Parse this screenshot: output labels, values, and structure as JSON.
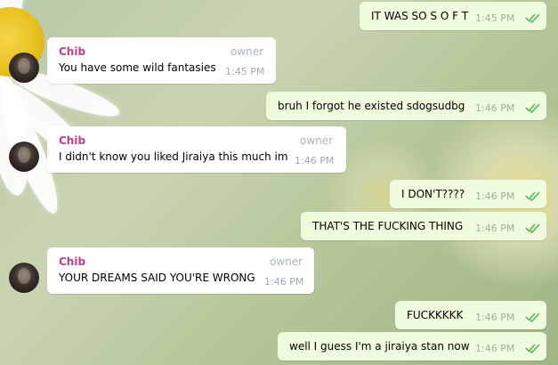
{
  "chat": {
    "colors": {
      "outgoing_bubble": "#effdde",
      "incoming_bubble": "#ffffff",
      "sender_name": "#c03d87",
      "read_check": "#5bb25b"
    },
    "messages": [
      {
        "direction": "out",
        "text": "IT WAS SO S O F T",
        "time": "1:45 PM",
        "status": "read"
      },
      {
        "direction": "in",
        "sender": "Chib",
        "role": "owner",
        "text": "You have some wild fantasies",
        "time": "1:45 PM"
      },
      {
        "direction": "out",
        "text": "bruh I forgot he existed sdogsudbg",
        "time": "1:46 PM",
        "status": "read"
      },
      {
        "direction": "in",
        "sender": "Chib",
        "role": "owner",
        "text": "I didn't know you liked Jiraiya this much im",
        "time": "1:46 PM"
      },
      {
        "direction": "out",
        "text": "I DON'T????",
        "time": "1:46 PM",
        "status": "read"
      },
      {
        "direction": "out",
        "text": "THAT'S THE FUCKING THING",
        "time": "1:46 PM",
        "status": "read"
      },
      {
        "direction": "in",
        "sender": "Chib",
        "role": "owner",
        "text": "YOUR DREAMS SAID YOU'RE WRONG",
        "time": "1:46 PM"
      },
      {
        "direction": "out",
        "text": "FUCKKKKK",
        "time": "1:46 PM",
        "status": "read"
      },
      {
        "direction": "out",
        "text": "well I guess I'm a jiraiya stan now",
        "time": "1:46 PM",
        "status": "read"
      }
    ]
  }
}
